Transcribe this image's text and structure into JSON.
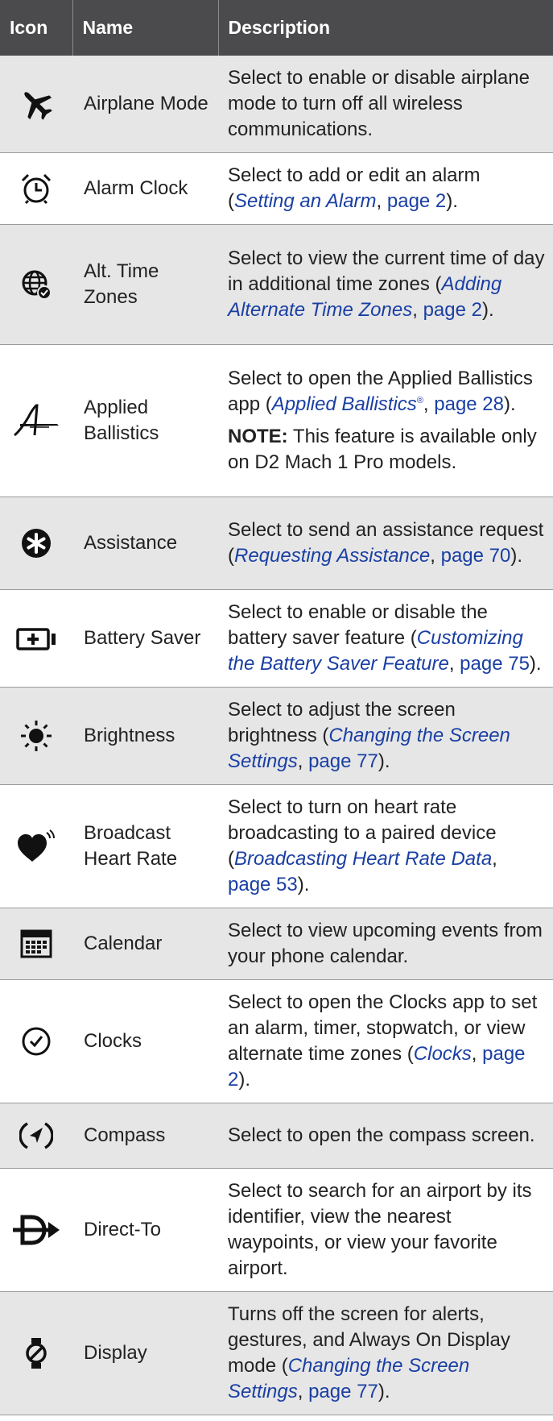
{
  "header": {
    "icon": "Icon",
    "name": "Name",
    "description": "Description"
  },
  "rows": [
    {
      "icon": "airplane-icon",
      "name": "Airplane Mode",
      "description": "Select to enable or disable airplane mode to turn off all wireless communications."
    },
    {
      "icon": "alarm-clock-icon",
      "name": "Alarm Clock",
      "description_pre": "Select to add or edit an alarm (",
      "link": "Setting an Alarm",
      "page": "page 2",
      "description_post": ")."
    },
    {
      "icon": "globe-clock-icon",
      "name": "Alt. Time Zones",
      "description_pre": "Select to view the current time of day in additional time zones (",
      "link": "Adding Alternate Time Zones",
      "page": "page 2",
      "description_post": ")."
    },
    {
      "icon": "applied-ballistics-icon",
      "name": "Applied Ballistics",
      "description_pre": "Select to open the Applied Ballistics app (",
      "link": "Applied Ballistics",
      "link_sup": "®",
      "page": "page 28",
      "description_post": ").",
      "note_label": "NOTE:",
      "note_text": " This feature is available only on D2 Mach 1 Pro models."
    },
    {
      "icon": "asterisk-circle-icon",
      "name": "Assistance",
      "description_pre": "Select to send an assistance request (",
      "link": "Requesting Assistance",
      "page": "page 70",
      "description_post": ")."
    },
    {
      "icon": "battery-plus-icon",
      "name": "Battery Saver",
      "description_pre": "Select to enable or disable the battery saver feature (",
      "link": "Customizing the Battery Saver Feature",
      "page": "page 75",
      "description_post": ")."
    },
    {
      "icon": "sun-icon",
      "name": "Brightness",
      "description_pre": "Select to adjust the screen brightness (",
      "link": "Changing the Screen Settings",
      "page": "page 77",
      "description_post": ")."
    },
    {
      "icon": "heart-broadcast-icon",
      "name": "Broadcast Heart Rate",
      "description_pre": "Select to turn on heart rate broadcasting to a paired device (",
      "link": "Broadcasting Heart Rate Data",
      "page": "page 53",
      "description_post": ")."
    },
    {
      "icon": "calendar-icon",
      "name": "Calendar",
      "description": "Select to view upcoming events from your phone calendar."
    },
    {
      "icon": "clock-check-icon",
      "name": "Clocks",
      "description_pre": "Select to open the Clocks app to set an alarm, timer, stopwatch, or view alternate time zones (",
      "link": "Clocks",
      "page": "page 2",
      "description_post": ")."
    },
    {
      "icon": "compass-icon",
      "name": "Compass",
      "description": "Select to open the compass screen."
    },
    {
      "icon": "direct-to-icon",
      "name": "Direct-To",
      "description": "Select to search for an airport by its identifier, view the nearest waypoints, or view your favorite airport."
    },
    {
      "icon": "watch-off-icon",
      "name": "Display",
      "description_pre": "Turns off the screen for alerts, gestures, and Always On Display mode (",
      "link": "Changing the Screen Settings",
      "page": "page 77",
      "description_post": ")."
    }
  ]
}
